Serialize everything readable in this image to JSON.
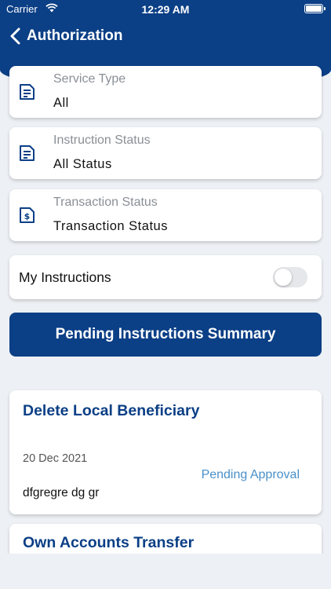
{
  "status_bar": {
    "carrier": "Carrier",
    "time": "12:29 AM"
  },
  "nav": {
    "title": "Authorization"
  },
  "filters": [
    {
      "label": "Service Type",
      "value": "All",
      "icon": "document-icon"
    },
    {
      "label": "Instruction Status",
      "value": "All Status",
      "icon": "document-icon"
    },
    {
      "label": "Transaction Status",
      "value": "Transaction Status",
      "icon": "dollar-document-icon"
    }
  ],
  "toggle": {
    "label": "My Instructions",
    "on": false
  },
  "summary_button": {
    "label": "Pending Instructions Summary"
  },
  "instructions": [
    {
      "title": "Delete Local Beneficiary",
      "date": "20 Dec 2021",
      "status": "Pending Approval",
      "note": "dfgregre dg gr"
    },
    {
      "title": "Own Accounts Transfer"
    }
  ],
  "colors": {
    "primary": "#0b3f86",
    "status_link": "#4a90c9",
    "background": "#edf0f4"
  }
}
